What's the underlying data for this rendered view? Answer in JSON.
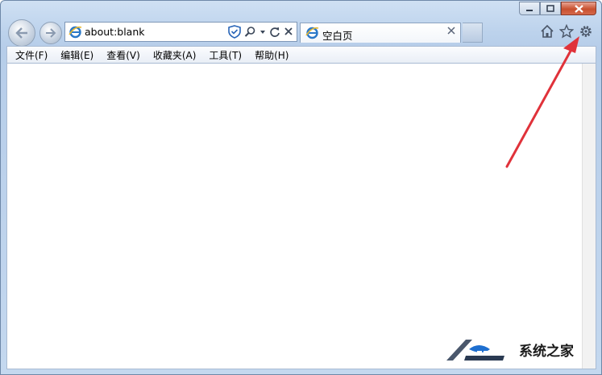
{
  "window": {
    "caption_buttons": [
      "minimize",
      "maximize",
      "close"
    ]
  },
  "navigation": {
    "back_icon": "back-arrow-icon",
    "forward_icon": "forward-arrow-icon"
  },
  "address": {
    "url": "about:blank",
    "tools": [
      "shield-icon",
      "search-icon",
      "dropdown-icon",
      "refresh-icon",
      "stop-icon"
    ]
  },
  "tabs": [
    {
      "label": "空白页",
      "active": true
    }
  ],
  "toolbar_right": [
    "home-icon",
    "favorites-star-icon",
    "gear-icon"
  ],
  "menu": {
    "items": [
      "文件(F)",
      "编辑(E)",
      "查看(V)",
      "收藏夹(A)",
      "工具(T)",
      "帮助(H)"
    ]
  },
  "annotation": {
    "arrow_color": "#e0323a"
  },
  "watermark": {
    "text": "系统之家"
  },
  "colors": {
    "frame": "#bcd2ec",
    "close_button": "#c8502f",
    "ie_blue": "#2a78c8"
  }
}
